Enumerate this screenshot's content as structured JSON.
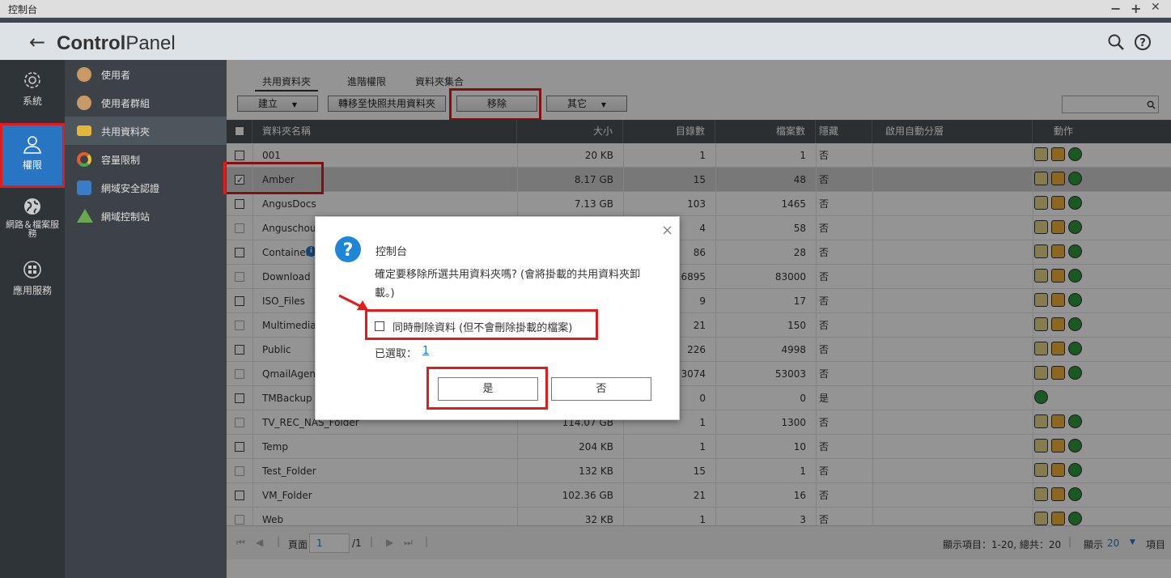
{
  "window": {
    "title": "控制台",
    "min": "−",
    "max": "+",
    "close": "✕"
  },
  "header": {
    "back": "←",
    "brand_bold": "Control",
    "brand_rest": "Panel"
  },
  "leftnav": [
    {
      "label": "系統",
      "icon": "gear-icon"
    },
    {
      "label": "權限",
      "icon": "user-icon"
    },
    {
      "label": "網路＆檔案服務",
      "icon": "globe-icon"
    },
    {
      "label": "應用服務",
      "icon": "apps-icon"
    }
  ],
  "subnav": [
    {
      "label": "使用者",
      "icon": "user-icon",
      "color": "#c99a63"
    },
    {
      "label": "使用者群組",
      "icon": "user-group-icon",
      "color": "#c99a63"
    },
    {
      "label": "共用資料夾",
      "icon": "shared-folder-icon",
      "color": "#e5b53a"
    },
    {
      "label": "容量限制",
      "icon": "quota-icon",
      "color": "#e55b2b"
    },
    {
      "label": "網域安全認證",
      "icon": "domain-security-icon",
      "color": "#3a7cc7"
    },
    {
      "label": "網域控制站",
      "icon": "domain-controller-icon",
      "color": "#6aa84f"
    }
  ],
  "tabs": [
    "共用資料夾",
    "進階權限",
    "資料夾集合"
  ],
  "toolbar": {
    "create": "建立",
    "migrate": "轉移至快照共用資料夾",
    "remove": "移除",
    "more": "其它"
  },
  "table": {
    "headers": [
      "資料夾名稱",
      "大小",
      "目錄數",
      "檔案數",
      "隱藏",
      "啟用自動分層",
      "動作"
    ],
    "rows": [
      {
        "name": "001",
        "size": "20 KB",
        "dirs": "1",
        "files": "1",
        "hidden": "否",
        "checked": false,
        "actions": 3
      },
      {
        "name": "Amber",
        "size": "8.17 GB",
        "dirs": "15",
        "files": "48",
        "hidden": "否",
        "checked": true,
        "actions": 3
      },
      {
        "name": "AngusDocs",
        "size": "7.13 GB",
        "dirs": "103",
        "files": "1465",
        "hidden": "否",
        "checked": false,
        "actions": 3
      },
      {
        "name": "Anguschou_",
        "size": "",
        "dirs": "4",
        "files": "58",
        "hidden": "否",
        "checked": false,
        "actions": 3
      },
      {
        "name": "Container",
        "size": "",
        "dirs": "86",
        "files": "28",
        "hidden": "否",
        "checked": false,
        "actions": 3
      },
      {
        "name": "Download",
        "size": "",
        "dirs": "26895",
        "files": "83000",
        "hidden": "否",
        "checked": false,
        "actions": 3
      },
      {
        "name": "ISO_Files",
        "size": "",
        "dirs": "9",
        "files": "17",
        "hidden": "否",
        "checked": false,
        "actions": 3
      },
      {
        "name": "Multimedia",
        "size": "",
        "dirs": "21",
        "files": "150",
        "hidden": "否",
        "checked": false,
        "actions": 3
      },
      {
        "name": "Public",
        "size": "",
        "dirs": "226",
        "files": "4998",
        "hidden": "否",
        "checked": false,
        "actions": 3
      },
      {
        "name": "QmailAgent",
        "size": "",
        "dirs": "3074",
        "files": "53003",
        "hidden": "否",
        "checked": false,
        "actions": 3
      },
      {
        "name": "TMBackup",
        "size": "",
        "dirs": "0",
        "files": "0",
        "hidden": "是",
        "checked": false,
        "actions": 1
      },
      {
        "name": "TV_REC_NAS_Folder",
        "size": "114.07 GB",
        "dirs": "1",
        "files": "1300",
        "hidden": "否",
        "checked": false,
        "actions": 3
      },
      {
        "name": "Temp",
        "size": "204 KB",
        "dirs": "1",
        "files": "10",
        "hidden": "否",
        "checked": false,
        "actions": 3
      },
      {
        "name": "Test_Folder",
        "size": "132 KB",
        "dirs": "15",
        "files": "1",
        "hidden": "否",
        "checked": false,
        "actions": 3
      },
      {
        "name": "VM_Folder",
        "size": "102.36 GB",
        "dirs": "21",
        "files": "16",
        "hidden": "否",
        "checked": false,
        "actions": 3
      },
      {
        "name": "Web",
        "size": "32 KB",
        "dirs": "1",
        "files": "3",
        "hidden": "否",
        "checked": false,
        "actions": 3
      }
    ]
  },
  "footer": {
    "page_label": "頁面",
    "page_value": "1",
    "page_total": "/1",
    "summary": "顯示項目：1-20, 總共：20",
    "show_label": "顯示",
    "per_page": "20",
    "items_label": "項目"
  },
  "dialog": {
    "title": "控制台",
    "message": "確定要移除所選共用資料夾嗎? (會將掛載的共用資料夾卸載。)",
    "checkbox_label": "同時刪除資料 (但不會刪除掛載的檔案)",
    "selected_label": "已選取：",
    "selected_count": "1",
    "yes": "是",
    "no": "否"
  },
  "colors": {
    "accent": "#2875c4",
    "highlight": "#e31b1b",
    "sidebar": "#2f3439"
  }
}
